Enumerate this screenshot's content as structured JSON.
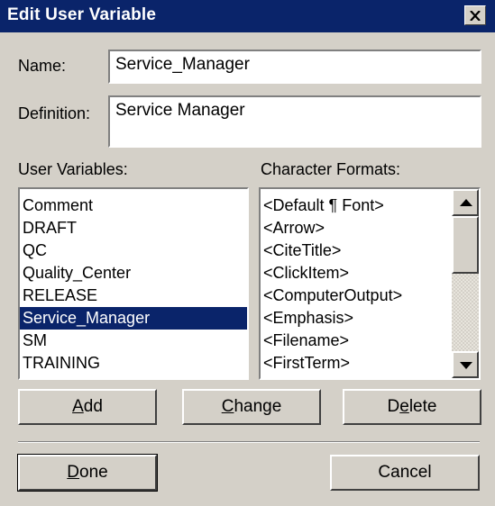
{
  "window": {
    "title": "Edit User Variable"
  },
  "name_field": {
    "label": "Name:",
    "value": "Service_Manager"
  },
  "definition_field": {
    "label": "Definition:",
    "value": "Service Manager"
  },
  "user_variables": {
    "label": "User Variables:",
    "items": [
      "Comment",
      "DRAFT",
      "QC",
      "Quality_Center",
      "RELEASE",
      "Service_Manager",
      "SM",
      "TRAINING"
    ],
    "selected": "Service_Manager"
  },
  "character_formats": {
    "label": "Character Formats:",
    "items": [
      "<Default ¶ Font>",
      "<Arrow>",
      "<CiteTitle>",
      "<ClickItem>",
      "<ComputerOutput>",
      "<Emphasis>",
      "<Filename>",
      "<FirstTerm>"
    ]
  },
  "buttons": {
    "add": {
      "pre": "",
      "key": "A",
      "post": "dd"
    },
    "change": {
      "pre": "",
      "key": "C",
      "post": "hange"
    },
    "delete": {
      "pre": "D",
      "key": "e",
      "post": "lete"
    },
    "done": {
      "pre": "",
      "key": "D",
      "post": "one"
    },
    "cancel": "Cancel"
  },
  "icons": {
    "close": "close-x-icon",
    "scroll_up": "arrow-up-icon",
    "scroll_down": "arrow-down-icon"
  },
  "colors": {
    "titlebar": "#0a246a",
    "selection": "#0a246a",
    "face": "#d4d0c8"
  }
}
